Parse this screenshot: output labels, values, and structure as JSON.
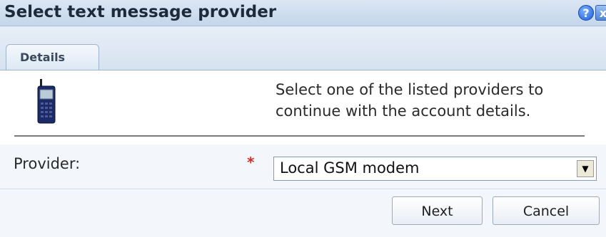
{
  "dialog": {
    "title": "Select text message provider",
    "help_icon": "?",
    "close_icon": "x"
  },
  "tabs": [
    {
      "label": "Details",
      "active": true
    }
  ],
  "content": {
    "icon": "mobile-phone-icon",
    "intro_text": "Select one of the listed providers to continue with the account details."
  },
  "form": {
    "provider_label": "Provider:",
    "required_mark": "*",
    "provider_value": "Local GSM modem",
    "dropdown_arrow": "▼"
  },
  "buttons": {
    "next_label": "Next",
    "cancel_label": "Cancel"
  },
  "colors": {
    "title_bar": "#c4d6eb",
    "required": "#e2261d",
    "help_icon": "#1a5ed8"
  }
}
